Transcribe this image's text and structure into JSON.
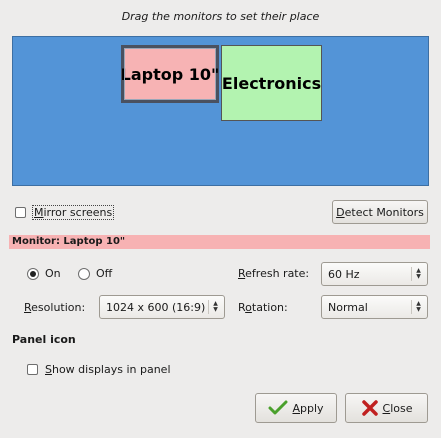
{
  "header": {
    "instruction": "Drag the monitors to set their place"
  },
  "arrangement": {
    "monitors": [
      {
        "label": "Laptop 10\"",
        "color": "#f7b3b4",
        "selected": true
      },
      {
        "label": "Electronics",
        "color": "#b3f3b0",
        "selected": false
      }
    ]
  },
  "mirror": {
    "label_u": "M",
    "label_rest": "irror screens",
    "checked": false
  },
  "detect": {
    "label_u": "D",
    "label_rest": "etect Monitors"
  },
  "monitor_section": {
    "title": "Monitor: Laptop 10\""
  },
  "power": {
    "on_label": "On",
    "off_label": "Off",
    "selected": "On"
  },
  "refresh": {
    "label_u": "R",
    "label_rest": "efresh rate:",
    "value": "60 Hz"
  },
  "resolution": {
    "label_u": "R",
    "label_rest": "esolution:",
    "value": "1024 x 600 (16:9)"
  },
  "rotation": {
    "label_pre": "R",
    "label_u": "o",
    "label_rest": "tation:",
    "value": "Normal"
  },
  "panel": {
    "title": "Panel icon",
    "show_label_u": "S",
    "show_label_rest": "how displays in panel",
    "checked": false
  },
  "footer": {
    "apply_u": "A",
    "apply_rest": "pply",
    "close_u": "C",
    "close_rest": "lose"
  },
  "colors": {
    "arrange_bg": "#5394d7",
    "monitor_bar": "#f7b2b3"
  }
}
